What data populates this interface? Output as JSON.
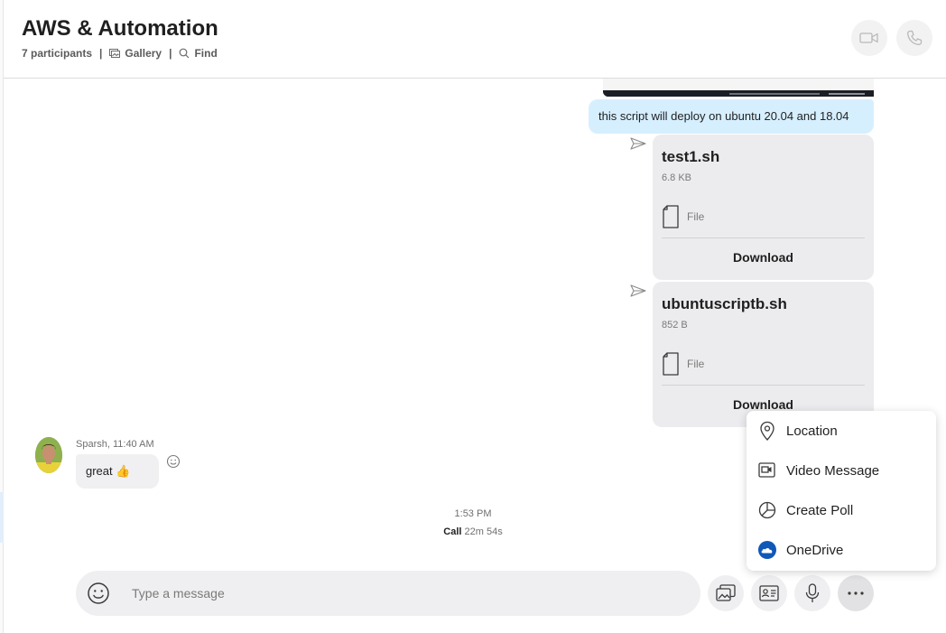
{
  "header": {
    "title": "AWS & Automation",
    "participants": "7 participants",
    "gallery_label": "Gallery",
    "find_label": "Find",
    "separator": "|"
  },
  "messages": {
    "sent_text": "this script will deploy on ubuntu 20.04 and 18.04",
    "files": [
      {
        "name": "test1.sh",
        "size": "6.8 KB",
        "type_label": "File",
        "download_label": "Download"
      },
      {
        "name": "ubuntuscriptb.sh",
        "size": "852 B",
        "type_label": "File",
        "download_label": "Download"
      }
    ],
    "received": {
      "meta": "Sparsh, 11:40 AM",
      "text": "great 👍"
    },
    "call": {
      "time": "1:53 PM",
      "label": "Call",
      "duration": "22m 54s"
    }
  },
  "composer": {
    "placeholder": "Type a message"
  },
  "more_menu": {
    "items": [
      {
        "label": "Location",
        "icon": "location-pin-icon"
      },
      {
        "label": "Video Message",
        "icon": "video-message-icon"
      },
      {
        "label": "Create Poll",
        "icon": "poll-icon"
      },
      {
        "label": "OneDrive",
        "icon": "onedrive-icon"
      }
    ]
  },
  "colors": {
    "sent_bubble": "#d6efff",
    "file_card": "#ececef",
    "onedrive_blue": "#0f58b8"
  }
}
